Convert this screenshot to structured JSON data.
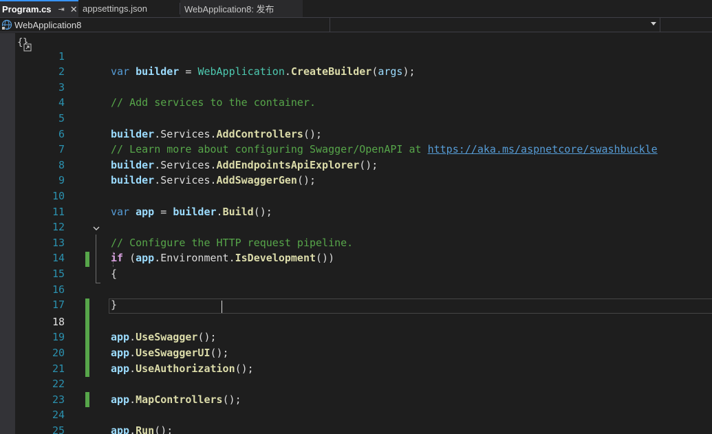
{
  "tabs": [
    {
      "label": "Program.cs",
      "active": true
    },
    {
      "label": "appsettings.json",
      "active": false
    },
    {
      "label": "WebApplication8: 发布",
      "active": false
    }
  ],
  "navbar": {
    "project": "WebApplication8",
    "member_dropdown": "",
    "type_dropdown": ""
  },
  "editor": {
    "current_line": 18,
    "lines": [
      {
        "n": "1"
      },
      {
        "n": "2"
      },
      {
        "n": "3"
      },
      {
        "n": "4"
      },
      {
        "n": "5"
      },
      {
        "n": "6"
      },
      {
        "n": "7"
      },
      {
        "n": "8"
      },
      {
        "n": "9"
      },
      {
        "n": "10"
      },
      {
        "n": "11"
      },
      {
        "n": "12"
      },
      {
        "n": "13"
      },
      {
        "n": "14"
      },
      {
        "n": "15"
      },
      {
        "n": "16"
      },
      {
        "n": "17"
      },
      {
        "n": "18"
      },
      {
        "n": "19"
      },
      {
        "n": "20"
      },
      {
        "n": "21"
      },
      {
        "n": "22"
      },
      {
        "n": "23"
      },
      {
        "n": "24"
      },
      {
        "n": "25"
      }
    ],
    "tokens": {
      "var": "var",
      "builder": "builder",
      "eq": " = ",
      "WebApplication": "WebApplication",
      "dot": ".",
      "CreateBuilder": "CreateBuilder",
      "args": "args",
      "open": "(",
      "close_semi": ");",
      "comment_services": "// Add services to the container.",
      "Services": "Services",
      "AddControllers": "AddControllers",
      "empty_call": "();",
      "comment_learn": "// Learn more about configuring Swagger/OpenAPI at ",
      "learn_url": "https://aka.ms/aspnetcore/swashbuckle",
      "AddEndpointsApiExplorer": "AddEndpointsApiExplorer",
      "AddSwaggerGen": "AddSwaggerGen",
      "app": "app",
      "Build": "Build",
      "comment_configure": "// Configure the HTTP request pipeline.",
      "if": "if",
      "if_open": " (",
      "Environment": "Environment",
      "IsDevelopment": "IsDevelopment",
      "if_close": "())",
      "brace_open": "{",
      "brace_close": "}",
      "UseSwagger": "UseSwagger",
      "UseSwaggerUI": "UseSwaggerUI",
      "UseAuthorization": "UseAuthorization",
      "MapControllers": "MapControllers",
      "Run": "Run"
    }
  },
  "colors": {
    "keyword": "#569cd6",
    "class": "#4ec9b0",
    "local": "#9cdcfe",
    "method": "#dcdcaa",
    "comment": "#57a64a",
    "line_number": "#2b91af",
    "change_bar": "#57a64a",
    "accent": "#3794ff"
  },
  "icons": {
    "pin": "pin-icon",
    "close": "close-icon",
    "project": "globe-icon",
    "code_namespace": "namespace-icon",
    "fold": "chevron-down-icon",
    "dropdown": "chevron-down-icon"
  }
}
